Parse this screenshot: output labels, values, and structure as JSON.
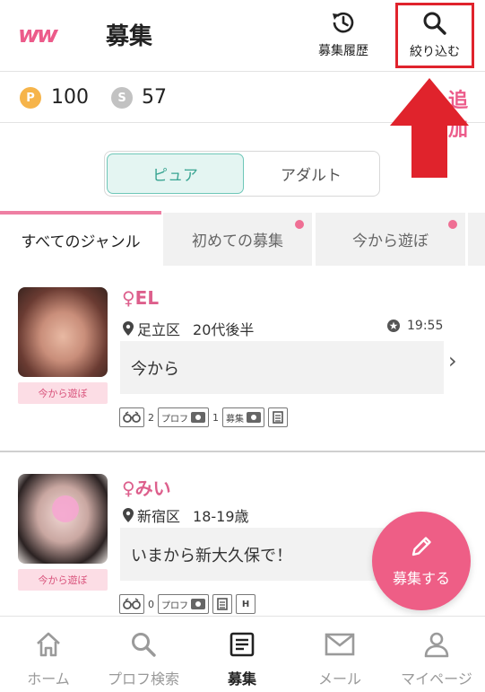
{
  "header": {
    "logo": "ww",
    "title": "募集",
    "history_label": "募集履歴",
    "filter_label": "絞り込む"
  },
  "points": {
    "p_symbol": "P",
    "p_value": "100",
    "s_symbol": "S",
    "s_value": "57",
    "add_label": "追加"
  },
  "segment": {
    "pure_label": "ピュア",
    "adult_label": "アダルト",
    "selected": "ピュア"
  },
  "tabs": [
    {
      "label": "すべてのジャンル",
      "active": true
    },
    {
      "label": "初めての募集",
      "has_dot": true
    },
    {
      "label": "今から遊ぼ",
      "has_dot": true
    }
  ],
  "posts": [
    {
      "gender_symbol": "♀",
      "name": "EL",
      "area": "足立区",
      "age": "20代後半",
      "time": "19:55",
      "message": "今から",
      "tag": "今から遊ぼ",
      "glasses_count": "2",
      "profile_label": "プロフ",
      "profile_photo_count": "1",
      "boshu_label": "募集"
    },
    {
      "gender_symbol": "♀",
      "name": "みい",
      "area": "新宿区",
      "age": "18-19歳",
      "message": "いまから新大久保で！",
      "tag": "今から遊ぼ",
      "glasses_count": "0",
      "profile_label": "プロフ",
      "h_label": "H"
    }
  ],
  "fab": {
    "label": "募集する"
  },
  "bottom_nav": [
    {
      "label": "ホーム",
      "icon": "home-icon"
    },
    {
      "label": "プロフ検索",
      "icon": "search-icon"
    },
    {
      "label": "募集",
      "icon": "list-icon",
      "active": true
    },
    {
      "label": "メール",
      "icon": "mail-icon"
    },
    {
      "label": "マイページ",
      "icon": "person-icon"
    }
  ],
  "colors": {
    "accent_pink": "#ec5b8a",
    "teal": "#3aa593",
    "annotation_red": "#e0232c"
  }
}
